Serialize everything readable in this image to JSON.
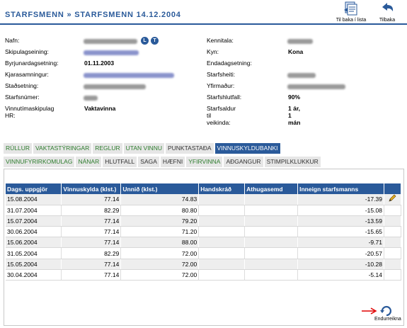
{
  "header": {
    "title_part1": "STARFSMENN",
    "title_sep": "»",
    "title_part2": "STARFSMENN 14.12.2004",
    "list_button_label": "Til baka í lista",
    "back_button_label": "Tilbaka"
  },
  "info_left": [
    {
      "label": "Nafn:",
      "value": ""
    },
    {
      "label": "Skipulagseining:",
      "value": ""
    },
    {
      "label": "Byrjunardagsetning:",
      "value": "01.11.2003"
    },
    {
      "label": "Kjarasamningur:",
      "value": ""
    },
    {
      "label": "Staðsetning:",
      "value": ""
    },
    {
      "label": "Starfsnúmer:",
      "value": ""
    },
    {
      "label": "Vinnutímaskipulag HR:",
      "value": "Vaktavinna"
    }
  ],
  "info_right": [
    {
      "label": "Kennitala:",
      "value": ""
    },
    {
      "label": "Kyn:",
      "value": "Kona"
    },
    {
      "label": "Endadagsetning:",
      "value": ""
    },
    {
      "label": "Starfsheiti:",
      "value": ""
    },
    {
      "label": "Yfirmaður:",
      "value": ""
    },
    {
      "label": "Starfshlutfall:",
      "value": "90%"
    },
    {
      "label": "Starfsaldur til veikinda:",
      "value": "1 ár, 1 mán"
    }
  ],
  "name_badges": [
    "L",
    "T"
  ],
  "tabs_row1": [
    {
      "label": "RÚLLUR",
      "style": "green"
    },
    {
      "label": "VAKTASTÝRINGAR",
      "style": "green"
    },
    {
      "label": "REGLUR",
      "style": "green"
    },
    {
      "label": "UTAN VINNU",
      "style": "green"
    },
    {
      "label": "PUNKTASTAÐA",
      "style": "dark"
    },
    {
      "label": "VINNUSKYLDUBANKI",
      "style": "active"
    }
  ],
  "tabs_row2": [
    {
      "label": "VINNUFYRIRKOMULAG",
      "style": "green"
    },
    {
      "label": "NÁNAR",
      "style": "green"
    },
    {
      "label": "HLUTFALL",
      "style": "dark"
    },
    {
      "label": "SAGA",
      "style": "dark"
    },
    {
      "label": "HÆFNI",
      "style": "dark"
    },
    {
      "label": "YFIRVINNA",
      "style": "green"
    },
    {
      "label": "AÐGANGUR",
      "style": "dark"
    },
    {
      "label": "STIMPILKLUKKUR",
      "style": "dark"
    }
  ],
  "table": {
    "columns": [
      "Dags. uppgjör",
      "Vinnuskylda (klst.)",
      "Unnið (klst.)",
      "Handskráð",
      "Athugasemd",
      "Inneign starfsmanns",
      ""
    ],
    "rows": [
      [
        "15.08.2004",
        "77.14",
        "74.83",
        "",
        "",
        "-17.39"
      ],
      [
        "31.07.2004",
        "82.29",
        "80.80",
        "",
        "",
        "-15.08"
      ],
      [
        "15.07.2004",
        "77.14",
        "79.20",
        "",
        "",
        "-13.59"
      ],
      [
        "30.06.2004",
        "77.14",
        "71.20",
        "",
        "",
        "-15.65"
      ],
      [
        "15.06.2004",
        "77.14",
        "88.00",
        "",
        "",
        "-9.71"
      ],
      [
        "31.05.2004",
        "82.29",
        "72.00",
        "",
        "",
        "-20.57"
      ],
      [
        "15.05.2004",
        "77.14",
        "72.00",
        "",
        "",
        "-10.28"
      ],
      [
        "30.04.2004",
        "77.14",
        "72.00",
        "",
        "",
        "-5.14"
      ]
    ]
  },
  "recalc_label": "Endurreikna",
  "colors": {
    "primary": "#2a5a9a",
    "tab_green": "#2e7d2e",
    "arrow_red": "#e00000"
  }
}
